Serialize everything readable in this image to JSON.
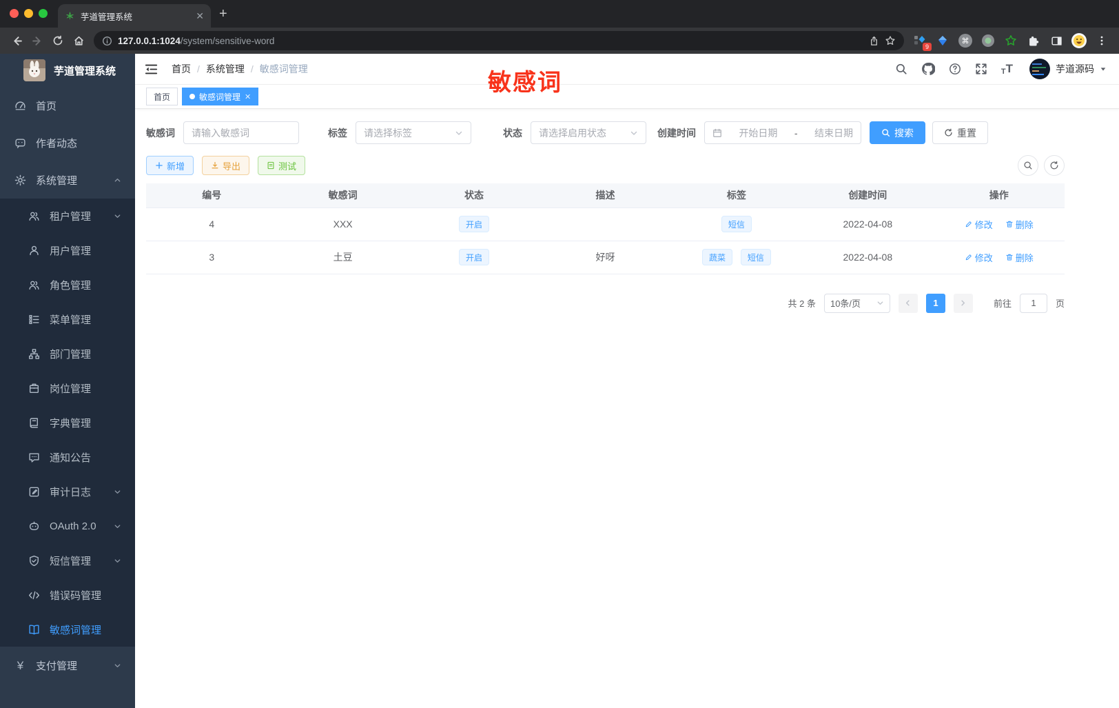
{
  "colors": {
    "primary": "#409eff",
    "warning": "#e6a23c",
    "success": "#67c23a",
    "annotation_red": "#f8331b",
    "sidebar_bg": "#2d3a4b",
    "submenu_bg": "#202b3b"
  },
  "browser": {
    "tab_title": "芋道管理系统",
    "url_host": "127.0.0.1:1024",
    "url_path": "/system/sensitive-word",
    "extension_badge": "9",
    "extension_icons": [
      "devtools-grid-icon",
      "kite-icon",
      "command-circle-icon",
      "record-circle-icon",
      "green-star-icon",
      "puzzle-icon",
      "side-panel-icon",
      "profile-emoji-icon",
      "menu-dots-icon"
    ]
  },
  "sidebar": {
    "logo_title": "芋道管理系统",
    "items": [
      {
        "label": "首页",
        "icon": "dashboard-icon"
      },
      {
        "label": "作者动态",
        "icon": "message-icon"
      },
      {
        "label": "系统管理",
        "icon": "gear-icon"
      },
      {
        "label": "租户管理",
        "icon": "tenants-icon"
      },
      {
        "label": "用户管理",
        "icon": "user-icon"
      },
      {
        "label": "角色管理",
        "icon": "roles-icon"
      },
      {
        "label": "菜单管理",
        "icon": "menu-tree-icon"
      },
      {
        "label": "部门管理",
        "icon": "org-icon"
      },
      {
        "label": "岗位管理",
        "icon": "post-icon"
      },
      {
        "label": "字典管理",
        "icon": "dict-icon"
      },
      {
        "label": "通知公告",
        "icon": "notice-icon"
      },
      {
        "label": "审计日志",
        "icon": "audit-icon"
      },
      {
        "label": "OAuth 2.0",
        "icon": "oauth-icon"
      },
      {
        "label": "短信管理",
        "icon": "sms-shield-icon"
      },
      {
        "label": "错误码管理",
        "icon": "code-icon"
      },
      {
        "label": "敏感词管理",
        "icon": "open-book-icon"
      },
      {
        "label": "支付管理",
        "icon": "yen-icon"
      }
    ]
  },
  "header": {
    "breadcrumb": {
      "0": "首页",
      "1": "系统管理",
      "2": "敏感词管理",
      "separator": "/"
    },
    "annotation": "敏感词",
    "username": "芋道源码"
  },
  "tags_bar": {
    "tabs": [
      {
        "label": "首页"
      },
      {
        "label": "敏感词管理"
      }
    ]
  },
  "filters": {
    "keyword_label": "敏感词",
    "keyword_placeholder": "请输入敏感词",
    "tag_label": "标签",
    "tag_placeholder": "请选择标签",
    "status_label": "状态",
    "status_placeholder": "请选择启用状态",
    "date_label": "创建时间",
    "date_start_placeholder": "开始日期",
    "date_separator": "-",
    "date_end_placeholder": "结束日期",
    "search_label": "搜索",
    "reset_label": "重置"
  },
  "toolbar": {
    "add_label": "新增",
    "export_label": "导出",
    "test_label": "测试"
  },
  "table": {
    "columns": [
      "编号",
      "敏感词",
      "状态",
      "描述",
      "标签",
      "创建时间",
      "操作"
    ],
    "rows": [
      {
        "id": "4",
        "word": "XXX",
        "status": "开启",
        "description": "",
        "tags": {
          "0": "短信"
        },
        "created": "2022-04-08",
        "edit": "修改",
        "delete": "删除"
      },
      {
        "id": "3",
        "word": "土豆",
        "status": "开启",
        "description": "好呀",
        "tags": {
          "0": "蔬菜",
          "1": "短信"
        },
        "created": "2022-04-08",
        "edit": "修改",
        "delete": "删除"
      }
    ]
  },
  "pagination": {
    "total": "共 2 条",
    "page_size": "10条/页",
    "current_page": "1",
    "goto_label": "前往",
    "goto_value": "1",
    "page_unit": "页"
  }
}
